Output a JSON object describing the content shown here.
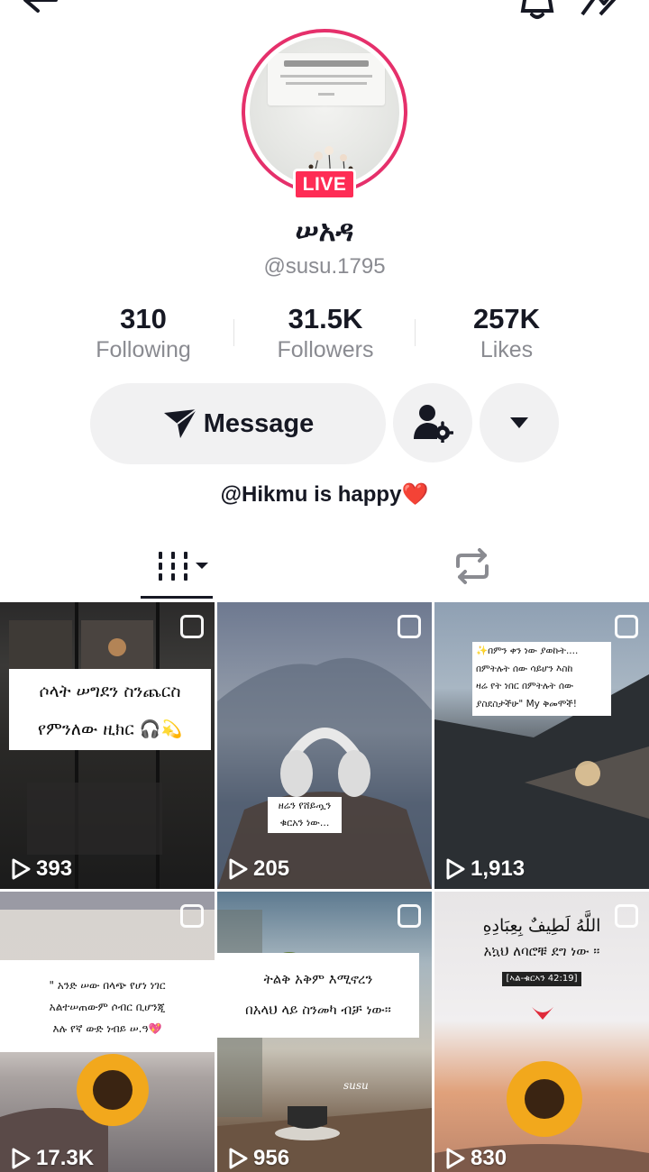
{
  "profile": {
    "display_name": "ሠአዳ",
    "username": "@susu.1795",
    "live_badge": "LIVE",
    "bio_text": "@Hikmu is happy",
    "bio_emoji": "❤️"
  },
  "stats": {
    "following_count": "310",
    "following_label": "Following",
    "followers_count": "31.5K",
    "followers_label": "Followers",
    "likes_count": "257K",
    "likes_label": "Likes"
  },
  "actions": {
    "message_label": "Message"
  },
  "icons": {
    "back": "back-arrow-icon",
    "bell": "bell-icon",
    "share": "share-icon",
    "message": "send-icon",
    "friend_settings": "person-gear-icon",
    "more": "triangle-down-icon",
    "videos_tab": "grid-icon",
    "repost_tab": "repost-icon",
    "play": "play-icon"
  },
  "colors": {
    "live": "#fe2c55",
    "ring": "#e5306b",
    "button_bg": "#f1f1f2",
    "secondary_text": "#8a8b91"
  },
  "videos": [
    {
      "views": "393",
      "caption_lines": [
        "ሶላት ሠግደን ስንጨርስ",
        "የምንለው ዚክር 🎧💫"
      ]
    },
    {
      "views": "205",
      "caption_lines": [
        "ዘሬን የሸይጧን",
        "ቁርአን ነው..."
      ]
    },
    {
      "views": "1,913",
      "caption_lines": [
        "✨በምን ቀን ነው ያወኩት....",
        "በምትሉት ሰው ሳይሆን እስከ",
        "ዛሬ የት ነበር በምትሉት ሰው",
        "ያስደስታችሁ\" My ቅመሞች!"
      ]
    },
    {
      "views": "17.3K",
      "caption_lines": [
        "\" አንድ ሠው በላጭ የሆነ ነገር",
        "አልተሠጠውም ሶብር ቢሆንጂ",
        "እሉ የኛ ውድ ነብይ ሠ.ዓ💖"
      ]
    },
    {
      "views": "956",
      "caption_lines": [
        "ትልቅ አቅም እሚኖረን",
        "በአላህ ላይ ስንመካ ብቻ ነው።"
      ],
      "watermark": "susu"
    },
    {
      "views": "830",
      "caption_lines": [
        "اللَّهُ لَطِيفٌ بِعِبَادِهِ",
        "አኳህ ለባሮቹ ደግ ነው ።",
        "[ኣል-ቁርኣን 42:19]"
      ]
    }
  ]
}
